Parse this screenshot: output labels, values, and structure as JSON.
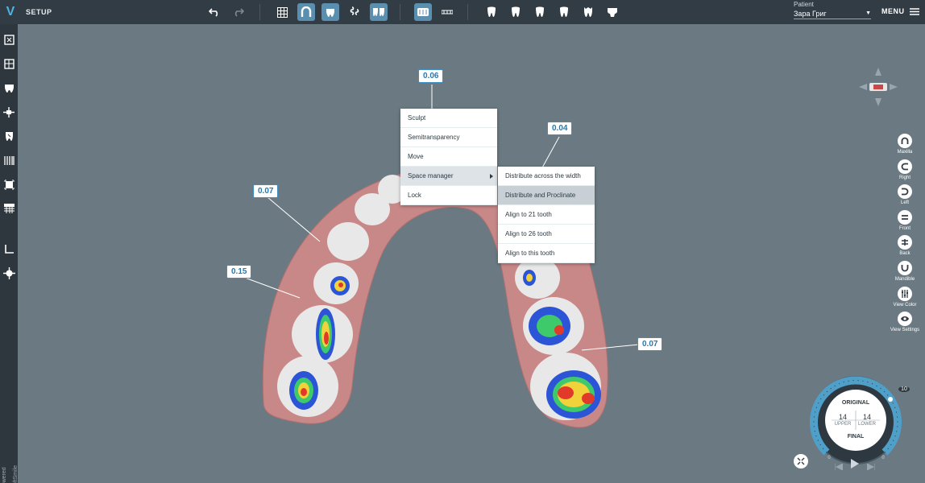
{
  "header": {
    "logo": "V",
    "title": "SETUP",
    "patient_label": "Patient",
    "patient_name": "Зара Григ",
    "menu_label": "MENU",
    "toolbar_icons": [
      "undo-icon",
      "redo-icon",
      "grid-icon",
      "arch-icon",
      "teeth-view-icon",
      "attachment-icon",
      "aligner-icon",
      "front-view-icon",
      "occlusal-view-icon",
      "tooth-1-icon",
      "tooth-2-icon",
      "tooth-3-icon",
      "tooth-4-icon",
      "tooth-5-icon",
      "tooth-6-icon"
    ]
  },
  "sidebar": {
    "tools": [
      "model-icon",
      "segmentation-icon",
      "teeth-icon",
      "align-icon",
      "tooth-edit-icon",
      "ipr-icon",
      "attachments-icon",
      "staging-icon",
      "measure-icon",
      "movement-icon"
    ],
    "powered_by": "Powered by SoftSmile"
  },
  "labels": {
    "l1": "0.06",
    "l2": "0.04",
    "l3": "0.07",
    "l4": "0.15",
    "l5": "0.07"
  },
  "context_menu": {
    "items": [
      "Sculpt",
      "Semitransparency",
      "Move",
      "Space manager",
      "Lock"
    ],
    "submenu": [
      "Distribute across the width",
      "Distribute and Proclinate",
      "Align to 21 tooth",
      "Align to 26 tooth",
      "Align to this tooth"
    ]
  },
  "views": {
    "maxilla": "Maxilla",
    "right": "Right",
    "left": "Left",
    "front": "Front",
    "back": "Back",
    "mandible": "Mandible",
    "view_color": "View Color",
    "view_settings": "View Settings"
  },
  "dial": {
    "original": "ORIGINAL",
    "final": "FINAL",
    "upper_count": "14",
    "lower_count": "14",
    "upper_label": "UPPER",
    "lower_label": "LOWER",
    "step_max": "10",
    "tick_start": "0",
    "tick_end": "0"
  },
  "colors": {
    "accent": "#5b8fb0",
    "background": "#6b7a82",
    "topbar": "#323c44",
    "label_border": "#3f8fc0",
    "dial_ring": "#4f9fc8"
  }
}
